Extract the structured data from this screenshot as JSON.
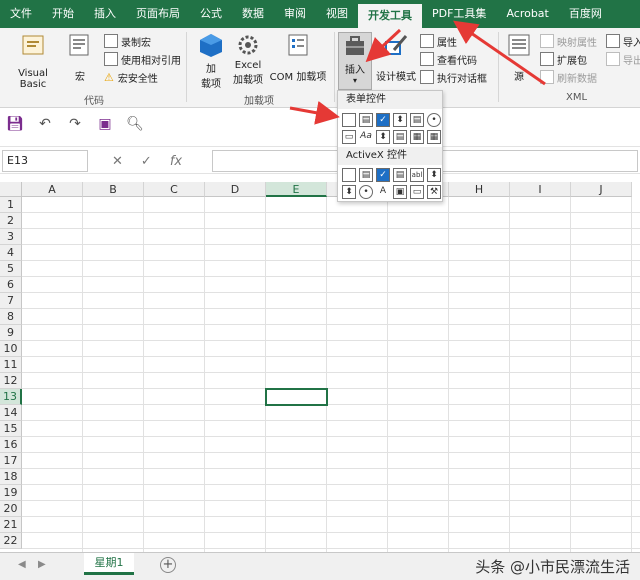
{
  "tabs": [
    "文件",
    "开始",
    "插入",
    "页面布局",
    "公式",
    "数据",
    "审阅",
    "视图",
    "开发工具",
    "PDF工具集",
    "Acrobat",
    "百度网"
  ],
  "active_tab": "开发工具",
  "ribbon": {
    "code_group": {
      "label": "代码",
      "visual_basic": "Visual Basic",
      "macro": "宏",
      "record_macro": "录制宏",
      "relative_ref": "使用相对引用",
      "macro_security": "宏安全性"
    },
    "addins_group": {
      "label": "加载项",
      "addins": "加\n载项",
      "addins_l1": "加",
      "addins_l2": "载项",
      "excel_addins_l1": "Excel",
      "excel_addins_l2": "加载项",
      "com_addins": "COM 加载项"
    },
    "controls_group": {
      "insert": "插入",
      "design_mode": "设计模式",
      "properties": "属性",
      "view_code": "查看代码",
      "run_dialog": "执行对话框"
    },
    "xml_group": {
      "label": "XML",
      "source": "源",
      "map_props": "映射属性",
      "expansion": "扩展包",
      "refresh": "刷新数据",
      "import": "导入",
      "export": "导出"
    }
  },
  "dropdown": {
    "form_controls": "表单控件",
    "activex_controls": "ActiveX 控件",
    "aa_label": "Aa",
    "a_label": "A",
    "abl_label": "abl"
  },
  "namebox": "E13",
  "fx": "fx",
  "columns": [
    "A",
    "B",
    "C",
    "D",
    "E",
    "F",
    "G",
    "H",
    "I",
    "J"
  ],
  "selected_column": "E",
  "rows": [
    "1",
    "2",
    "3",
    "4",
    "5",
    "6",
    "7",
    "8",
    "9",
    "10",
    "11",
    "12",
    "13",
    "14",
    "15",
    "16",
    "17",
    "18",
    "19",
    "20",
    "21",
    "22"
  ],
  "selected_row": "13",
  "sheet_tab": "星期1",
  "watermark": "头条 @小市民漂流生活",
  "colors": {
    "accent": "#217346",
    "arrow": "#e53935"
  }
}
